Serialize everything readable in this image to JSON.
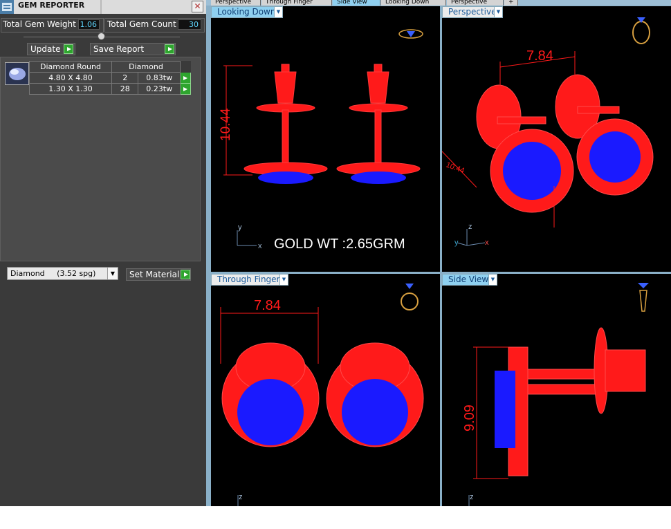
{
  "panel": {
    "title": "GEM REPORTER",
    "close_glyph": "✕",
    "total_gem_weight_label": "Total Gem Weight",
    "total_gem_weight_value": "1.06",
    "total_gem_count_label": "Total Gem Count",
    "total_gem_count_value": "30",
    "update_label": "Update",
    "save_report_label": "Save Report",
    "gem_table": {
      "headers": [
        "Diamond Round",
        "Diamond"
      ],
      "rows": [
        {
          "size": "4.80 X 4.80",
          "count": "2",
          "weight": "0.83tw"
        },
        {
          "size": "1.30 X 1.30",
          "count": "28",
          "weight": "0.23tw"
        }
      ]
    },
    "material_select": {
      "name": "Diamond",
      "density": "(3.52 spg)"
    },
    "set_material_label": "Set Material"
  },
  "top_tabs": [
    "Perspective",
    "Through Finger",
    "Side View",
    "Looking Down",
    "Perspective",
    "+"
  ],
  "viewports": [
    {
      "label": "Looking Down",
      "annotation": "GOLD WT :2.65GRM",
      "dimension": "10.44",
      "axes": [
        "y",
        "x"
      ]
    },
    {
      "label": "Perspective",
      "dimension": "7.84",
      "dimension_2": "10.44",
      "axes": [
        "z",
        "y",
        "x"
      ]
    },
    {
      "label": "Through Finger",
      "dimension": "7.84",
      "axes": [
        "z"
      ]
    },
    {
      "label": "Side View",
      "dimension": "9.09",
      "axes": [
        "z"
      ]
    }
  ],
  "colors": {
    "metal": "#ff1a1a",
    "gem": "#1a1aff",
    "panel_bg": "#3a3a3a",
    "viewport_bg": "#000000",
    "active_tab": "#8fd0f0"
  },
  "icons": [
    "gem-reporter-logo",
    "close-icon",
    "play-icon",
    "ring-icon",
    "diamond-icon",
    "earring-icon",
    "dropdown-arrow-icon"
  ]
}
